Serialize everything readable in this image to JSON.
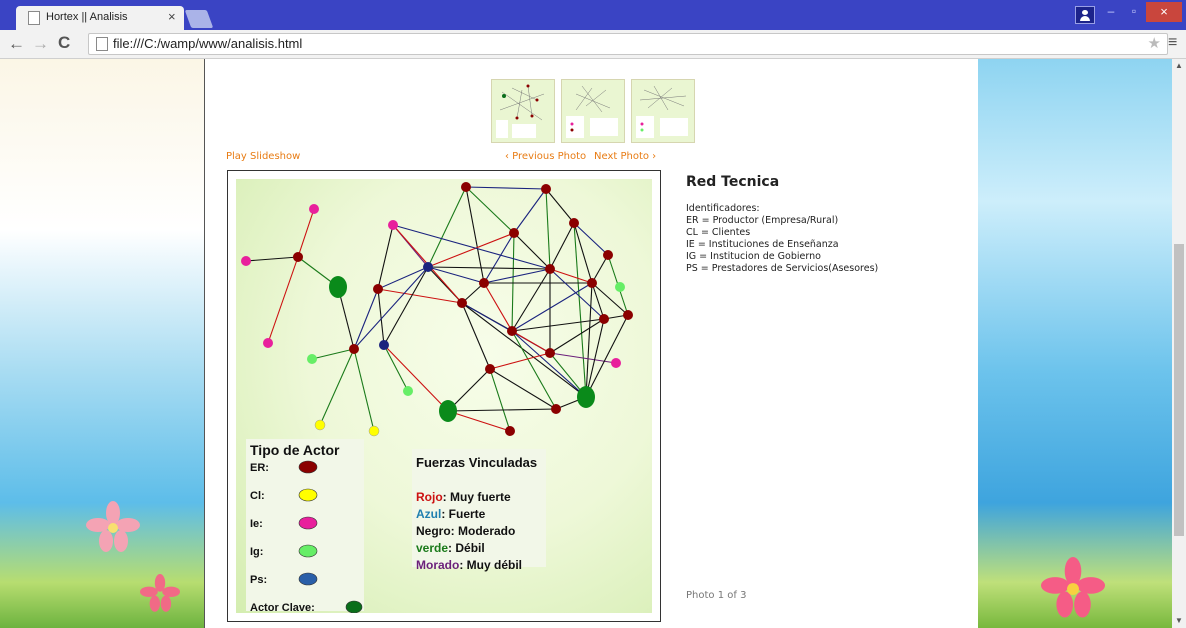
{
  "browser": {
    "tab_title": "Hortex || Analisis",
    "tab_close": "×",
    "url": "file:///C:/wamp/www/analisis.html",
    "min_glyph": "–",
    "max_glyph": "▫",
    "close_glyph": "×"
  },
  "gallery": {
    "play_slideshow": "Play Slideshow",
    "previous_photo": "‹ Previous Photo",
    "next_photo": "Next Photo ›",
    "photo_counter": "Photo 1 of 3",
    "caption_title": "Red Tecnica",
    "caption_lines": [
      "Identificadores:",
      "ER = Productor (Empresa/Rural)",
      "CL = Clientes",
      "IE = Instituciones de Enseñanza",
      "IG = Institucion de Gobierno",
      "PS = Prestadores de Servicios(Asesores)"
    ]
  },
  "network_image": {
    "legend_actor_title": "Tipo de Actor",
    "legend_actor_items": [
      {
        "label": "ER:",
        "color": "#8b0000"
      },
      {
        "label": "Cl:",
        "color": "#ffff00"
      },
      {
        "label": "Ie:",
        "color": "#e8209c"
      },
      {
        "label": "Ig:",
        "color": "#66ee66"
      },
      {
        "label": "Ps:",
        "color": "#2a5fa8"
      },
      {
        "label": "Actor Clave:",
        "color": "#0a6e1a"
      }
    ],
    "legend_forces_title": "Fuerzas Vinculadas",
    "legend_forces_items": [
      {
        "key": "Rojo",
        "desc": ": Muy fuerte",
        "color": "#cc1111"
      },
      {
        "key": "Azul",
        "desc": ": Fuerte",
        "color": "#1f7fb0"
      },
      {
        "key": "Negro",
        "desc": ": Moderado",
        "color": "#111111"
      },
      {
        "key": "verde",
        "desc": ": Débil",
        "color": "#1a7a1a"
      },
      {
        "key": "Morado",
        "desc": ": Muy débil",
        "color": "#6b1f7a"
      }
    ]
  }
}
